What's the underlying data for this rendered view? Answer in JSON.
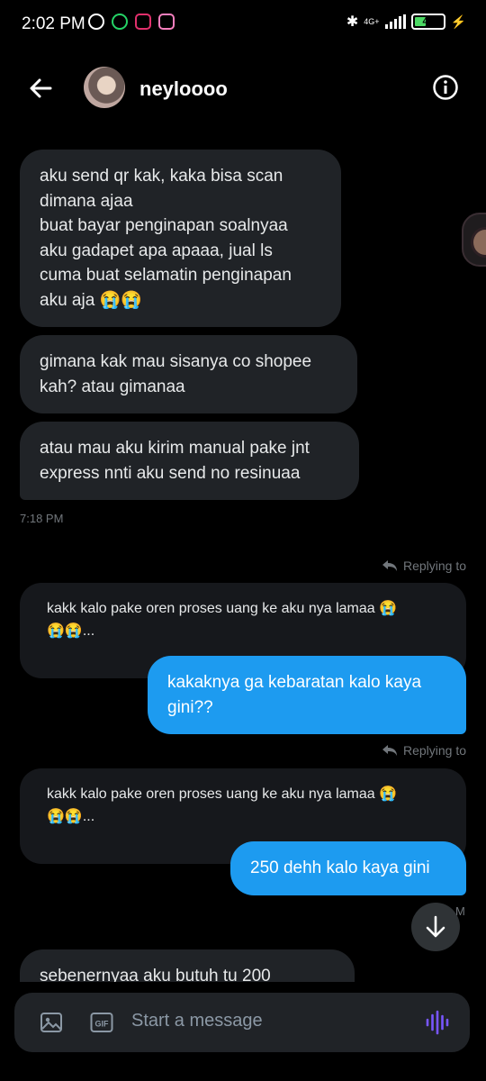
{
  "status_bar": {
    "time": "2:02 PM",
    "network": "4G+",
    "battery": "40",
    "battery_level": 0.4,
    "icons": [
      "alarm-icon",
      "whatsapp-icon",
      "instagram-icon",
      "instagram-icon",
      "bluetooth-icon",
      "signal-icon",
      "battery-icon",
      "charging-icon"
    ]
  },
  "header": {
    "username": "neyloooo",
    "icons": [
      "back-arrow-icon",
      "avatar",
      "info-icon"
    ]
  },
  "messages": {
    "m1": "aku send qr kak, kaka bisa scan\ndimana ajaa\nbuat bayar penginapan soalnyaa\naku gadapet apa apaaa, jual ls\ncuma buat selamatin penginapan\naku aja 😭😭",
    "m2": "gimana kak mau sisanya co shopee\nkah? atau gimanaa",
    "m3": "atau mau aku kirim manual pake jnt\nexpress nnti aku send no resinuaa",
    "ts1": "7:18 PM",
    "reply1_label": "Replying to",
    "quote1": "kakk kalo pake oren proses uang ke aku nya lamaa 😭\n😭😭...",
    "out1": "kakaknya ga kebaratan kalo kaya\ngini??",
    "reply2_label": "Replying to",
    "quote2": "kakk kalo pake oren proses uang ke aku nya lamaa 😭\n😭😭...",
    "out2": "250 dehh kalo kaya gini",
    "ts2_partial": "M",
    "m4_partial": "sebenernyaa aku butuh tu 200"
  },
  "composer": {
    "placeholder": "Start a message",
    "gif_label": "GIF"
  },
  "colors": {
    "background": "#000000",
    "incoming_bubble": "#202327",
    "outgoing_bubble": "#1d9bf0",
    "muted_text": "#71767b",
    "voice_accent": "#7856ff"
  }
}
